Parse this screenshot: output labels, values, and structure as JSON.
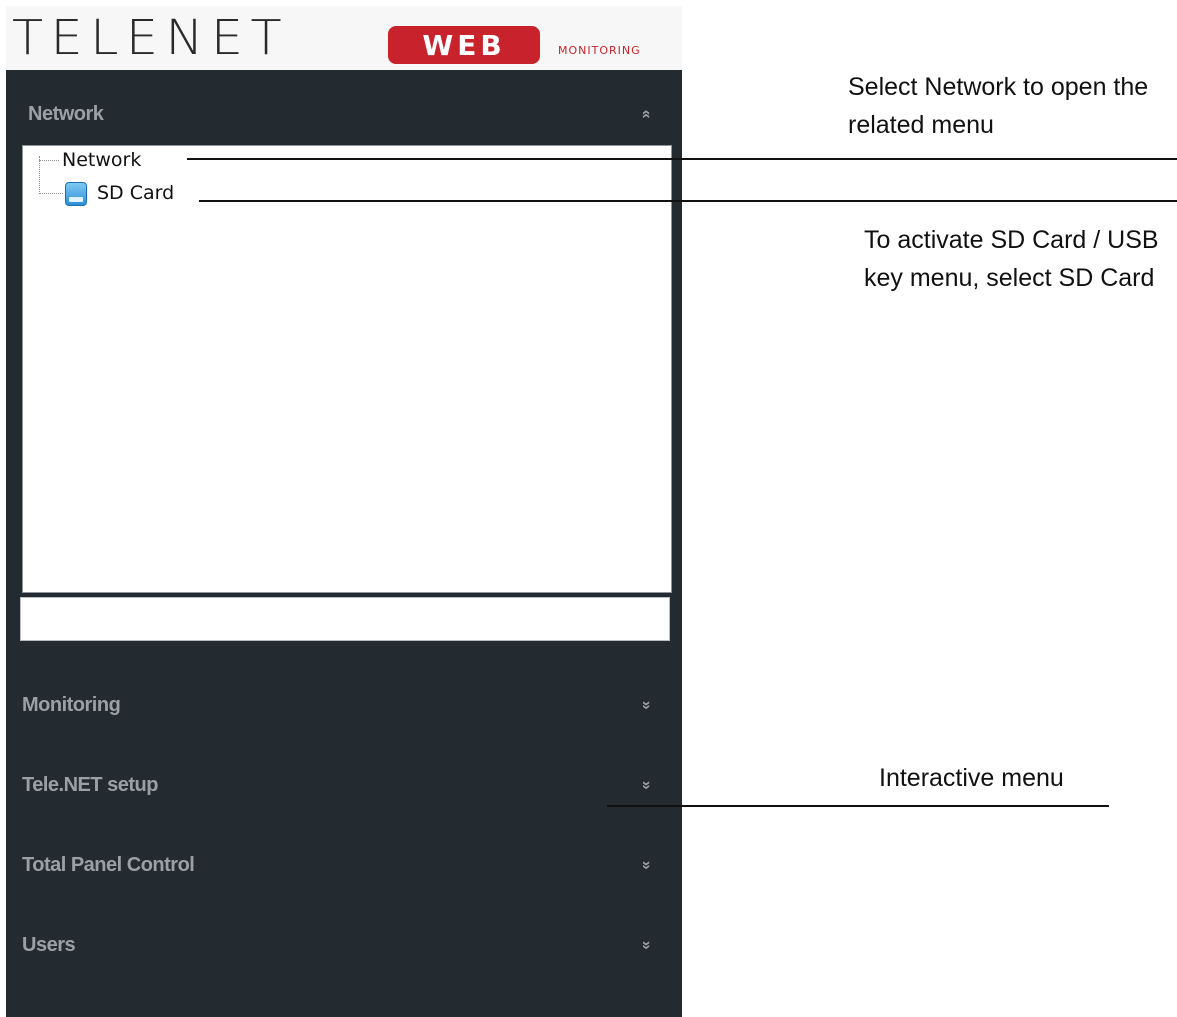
{
  "logo": {
    "brand": "TELENET",
    "badge": "WEB",
    "tagline": "MONITORING"
  },
  "sidebar": {
    "network_section": {
      "label": "Network",
      "chevron": "«"
    },
    "tree": {
      "items": [
        {
          "label": "Network",
          "icon": ""
        },
        {
          "label": "SD Card",
          "icon": "sd-card-icon"
        }
      ]
    },
    "sections": [
      {
        "label": "Monitoring",
        "chevron": "»"
      },
      {
        "label": "Tele.NET setup",
        "chevron": "»"
      },
      {
        "label": "Total Panel Control",
        "chevron": "»"
      },
      {
        "label": "Users",
        "chevron": "»"
      }
    ]
  },
  "annotations": {
    "network": "Select Network to open the related menu",
    "sdcard": "To activate SD Card / USB key menu, select SD Card",
    "interactive": "Interactive menu"
  },
  "colors": {
    "panel_bg": "#232a30",
    "brand_red": "#c8232c",
    "section_text": "#9aa0a5"
  }
}
